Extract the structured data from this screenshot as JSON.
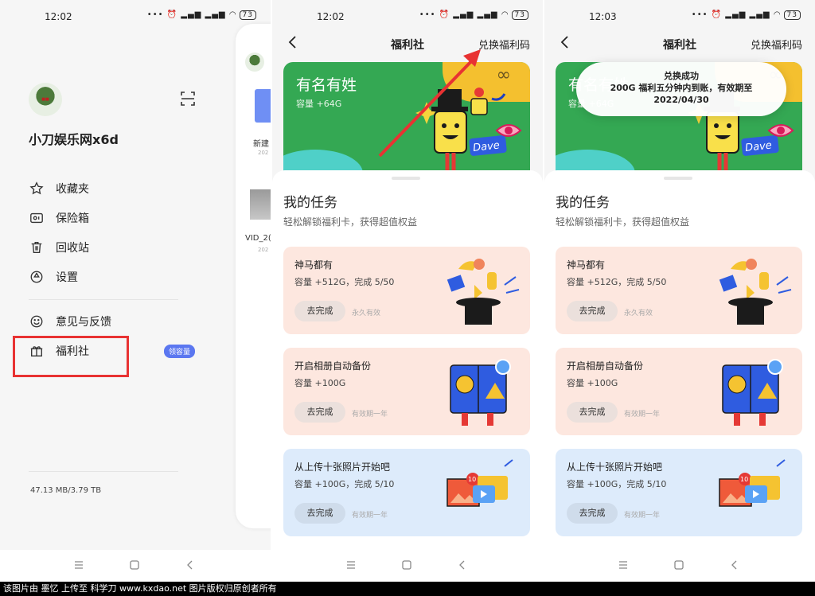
{
  "panel1": {
    "status": {
      "time": "12:02",
      "battery": "73"
    },
    "user_name": "小刀娱乐网x6d",
    "menu": [
      {
        "label": "收藏夹",
        "icon": "star-icon"
      },
      {
        "label": "保险箱",
        "icon": "safe-icon"
      },
      {
        "label": "回收站",
        "icon": "trash-icon"
      },
      {
        "label": "设置",
        "icon": "settings-icon"
      },
      {
        "label": "意见与反馈",
        "icon": "smile-icon"
      },
      {
        "label": "福利社",
        "icon": "gift-icon"
      }
    ],
    "badge": "领容量",
    "storage": "47.13 MB/3.79 TB",
    "peek": {
      "folder_label": "新建",
      "folder_date": "202",
      "video_label": "VID_2(",
      "video_date": "202"
    }
  },
  "panel2": {
    "status": {
      "time": "12:02",
      "battery": "73"
    },
    "title": "福利社",
    "redeem": "兑换福利码"
  },
  "panel3": {
    "status": {
      "time": "12:03",
      "battery": "73"
    },
    "title": "福利社",
    "redeem": "兑换福利码",
    "toast": {
      "line1": "兑换成功",
      "line2": "200G 福利五分钟内到账，有效期至",
      "line3": "2022/04/30"
    }
  },
  "hero": {
    "title": "有名有姓",
    "subtitle": "容量 +64G",
    "badge_text": "Dave"
  },
  "tasks_section": {
    "title": "我的任务",
    "subtitle": "轻松解锁福利卡，获得超值权益"
  },
  "tasks": [
    {
      "title": "神马都有",
      "desc": "容量 +512G，完成 5/50",
      "button": "去完成",
      "note": "永久有效",
      "color": "pink"
    },
    {
      "title": "开启相册自动备份",
      "desc": "容量 +100G",
      "button": "去完成",
      "note": "有效期一年",
      "color": "pink"
    },
    {
      "title": "从上传十张照片开始吧",
      "desc": "容量 +100G，完成 5/10",
      "button": "去完成",
      "note": "有效期一年",
      "color": "blue"
    }
  ],
  "upload_count": "10",
  "footer": "该图片由 墨忆 上传至 科学刀 www.kxdao.net 图片版权归原创者所有",
  "colors": {
    "accent_blue": "#5b77f0",
    "highlight_red": "#e83232",
    "hero_green": "#34a853",
    "card_pink": "#fde7df",
    "card_blue": "#ddebfb"
  }
}
